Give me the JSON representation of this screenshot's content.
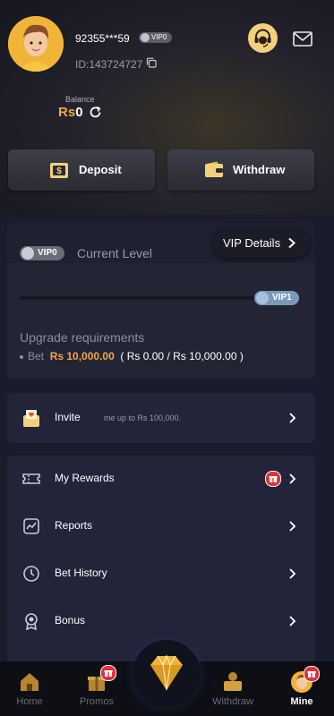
{
  "header": {
    "username": "92355***59",
    "vip_badge": "VIP0",
    "user_id": "ID:143724727",
    "balance_label": "Balance",
    "balance_currency": "Rs",
    "balance_value": "0"
  },
  "actions": {
    "deposit": "Deposit",
    "withdraw": "Withdraw"
  },
  "vip_card": {
    "current_vip": "VIP0",
    "current_level_label": "Current Level",
    "details_label": "VIP Details",
    "next_vip": "VIP1",
    "upgrade_title": "Upgrade requirements",
    "bet_label": "Bet",
    "bet_amount": "Rs 10,000.00",
    "bet_range": "( Rs 0.00 / Rs 10,000.00 )",
    "progress": 0
  },
  "invite": {
    "label": "Invite",
    "marquee": "me up to Rs 100,000."
  },
  "menu": [
    {
      "label": "My Rewards",
      "icon": "ticket-icon"
    },
    {
      "label": "Reports",
      "icon": "chart-icon"
    },
    {
      "label": "Bet History",
      "icon": "history-icon"
    },
    {
      "label": "Bonus",
      "icon": "medal-icon"
    }
  ],
  "nav": {
    "home": "Home",
    "promos": "Promos",
    "withdraw": "Withdraw",
    "mine": "Mine"
  },
  "colors": {
    "accent": "#f4a64d",
    "background": "#1a1b2c",
    "badge": "#e2303a"
  }
}
